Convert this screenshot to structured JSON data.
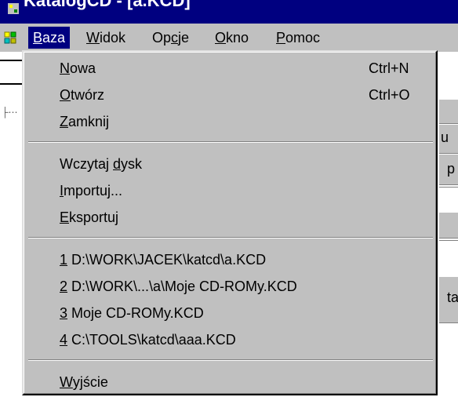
{
  "window": {
    "title": "KatalogCD - [a.KCD]"
  },
  "menubar": {
    "items": [
      {
        "ul": "B",
        "rest": "aza"
      },
      {
        "ul": "W",
        "rest": "idok"
      },
      {
        "pre": "Op",
        "ul": "c",
        "rest": "je"
      },
      {
        "ul": "O",
        "rest": "kno"
      },
      {
        "ul": "P",
        "rest": "omoc"
      }
    ]
  },
  "background": {
    "letters": [
      "u",
      "p",
      "ta"
    ]
  },
  "dropdown": {
    "groups": [
      [
        {
          "ul": "N",
          "rest": "owa",
          "shortcut": "Ctrl+N"
        },
        {
          "ul": "O",
          "rest": "twórz",
          "shortcut": "Ctrl+O"
        },
        {
          "ul": "Z",
          "rest": "amknij",
          "shortcut": ""
        }
      ],
      [
        {
          "pre": "Wczytaj ",
          "ul": "d",
          "rest": "ysk",
          "shortcut": ""
        },
        {
          "ul": "I",
          "rest": "mportuj...",
          "shortcut": ""
        },
        {
          "ul": "E",
          "rest": "ksportuj",
          "shortcut": ""
        }
      ],
      [
        {
          "ul": "1",
          "rest": " D:\\WORK\\JACEK\\katcd\\a.KCD",
          "shortcut": ""
        },
        {
          "ul": "2",
          "rest": " D:\\WORK\\...\\a\\Moje CD-ROMy.KCD",
          "shortcut": ""
        },
        {
          "ul": "3",
          "rest": " Moje CD-ROMy.KCD",
          "shortcut": ""
        },
        {
          "ul": "4",
          "rest": " C:\\TOOLS\\katcd\\aaa.KCD",
          "shortcut": ""
        }
      ],
      [
        {
          "ul": "W",
          "rest": "yjście",
          "shortcut": ""
        }
      ]
    ]
  }
}
